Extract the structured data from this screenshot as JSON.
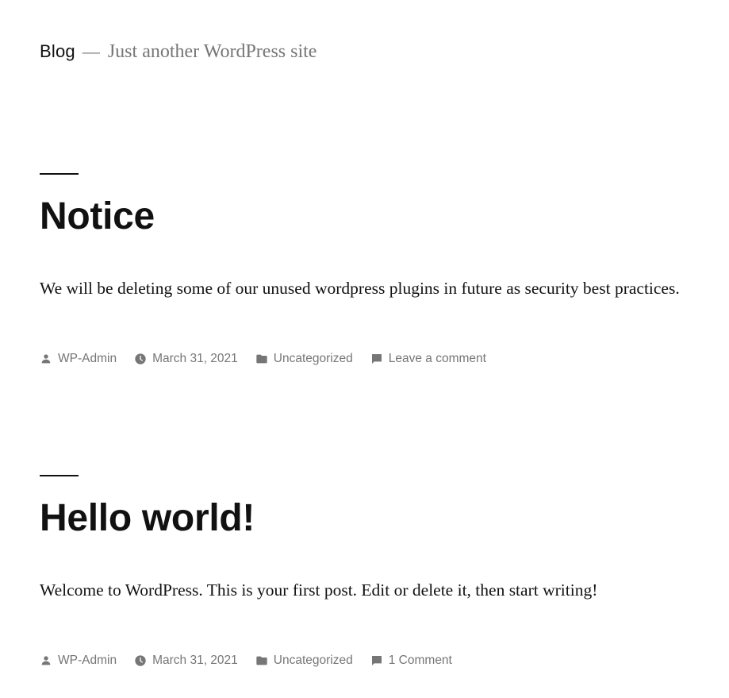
{
  "site": {
    "title": "Blog",
    "separator": "—",
    "description": "Just another WordPress site"
  },
  "posts": [
    {
      "title": "Notice",
      "excerpt": "We will be deleting some of our unused wordpress plugins in future as security best practices.",
      "meta": {
        "author_label": "Posted by",
        "author": "WP-Admin",
        "date_label": "Posted on",
        "date": "March 31, 2021",
        "category_label": "Posted in",
        "category": "Uncategorized",
        "comments": "Leave a comment"
      }
    },
    {
      "title": "Hello world!",
      "excerpt": "Welcome to WordPress. This is your first post. Edit or delete it, then start writing!",
      "meta": {
        "author_label": "Posted by",
        "author": "WP-Admin",
        "date_label": "Posted on",
        "date": "March 31, 2021",
        "category_label": "Posted in",
        "category": "Uncategorized",
        "comments": "1 Comment"
      }
    }
  ],
  "icons": {
    "author": "person-icon",
    "date": "clock-icon",
    "category": "folder-icon",
    "comments": "comment-icon"
  },
  "colors": {
    "text": "#111111",
    "muted": "#767676",
    "background": "#ffffff"
  }
}
